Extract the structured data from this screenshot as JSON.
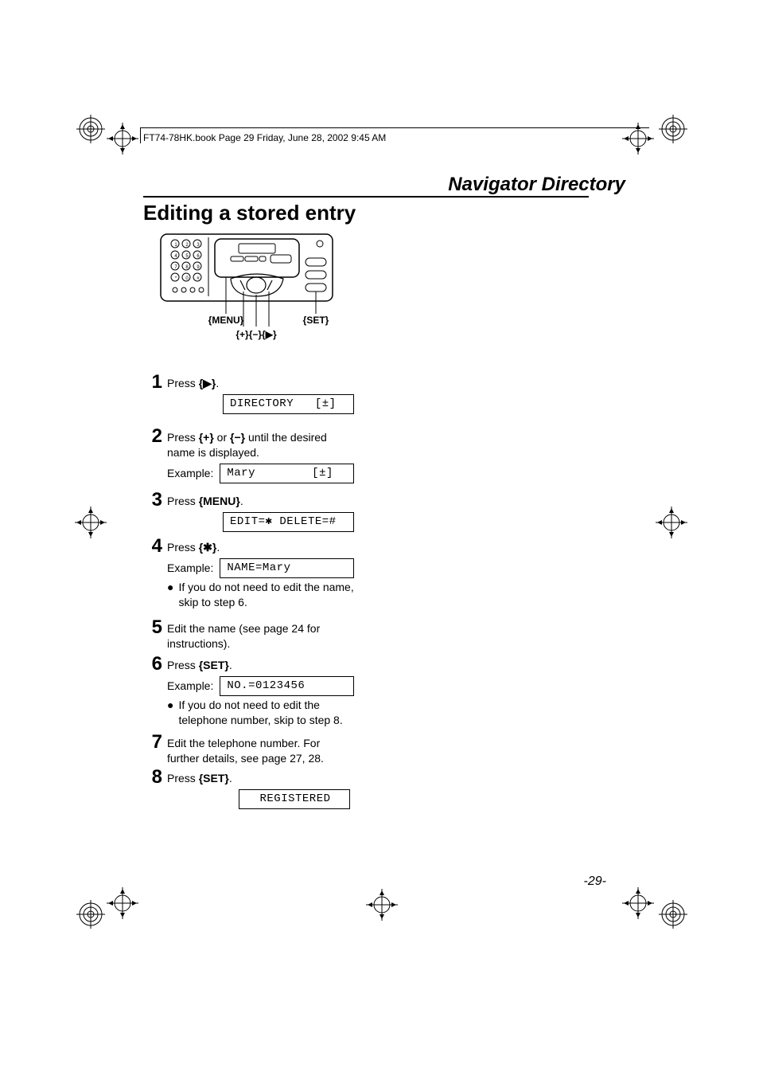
{
  "header_line": "FT74-78HK.book  Page 29  Friday, June 28, 2002  9:45 AM",
  "section_title": "Navigator Directory",
  "main_title": "Editing a stored entry",
  "labels": {
    "menu": "MENU",
    "set": "SET",
    "plus": "+",
    "minus": "−",
    "right": "▶"
  },
  "steps": {
    "s1": {
      "num": "1",
      "text_a": "Press ",
      "key": "▶",
      "text_b": ".",
      "lcd": "DIRECTORY   [±]"
    },
    "s2": {
      "num": "2",
      "text_a": "Press ",
      "key1": "+",
      "mid": " or ",
      "key2": "−",
      "text_b": " until the desired name is displayed.",
      "example_label": "Example:",
      "lcd": "Mary        [±]"
    },
    "s3": {
      "num": "3",
      "text_a": "Press ",
      "key": "MENU",
      "text_b": ".",
      "lcd": "EDIT=✱ DELETE=#"
    },
    "s4": {
      "num": "4",
      "text_a": "Press ",
      "key": "✱",
      "text_b": ".",
      "example_label": "Example:",
      "lcd": "NAME=Mary",
      "bullet": "If you do not need to edit the name, skip to step 6."
    },
    "s5": {
      "num": "5",
      "text": "Edit the name (see page 24 for instructions)."
    },
    "s6": {
      "num": "6",
      "text_a": "Press ",
      "key": "SET",
      "text_b": ".",
      "example_label": "Example:",
      "lcd": "NO.=0123456",
      "bullet": "If you do not need to edit the telephone number, skip to step 8."
    },
    "s7": {
      "num": "7",
      "text": "Edit the telephone number. For further details, see page 27, 28."
    },
    "s8": {
      "num": "8",
      "text_a": "Press ",
      "key": "SET",
      "text_b": ".",
      "lcd": "REGISTERED"
    }
  },
  "page_number": "-29-"
}
